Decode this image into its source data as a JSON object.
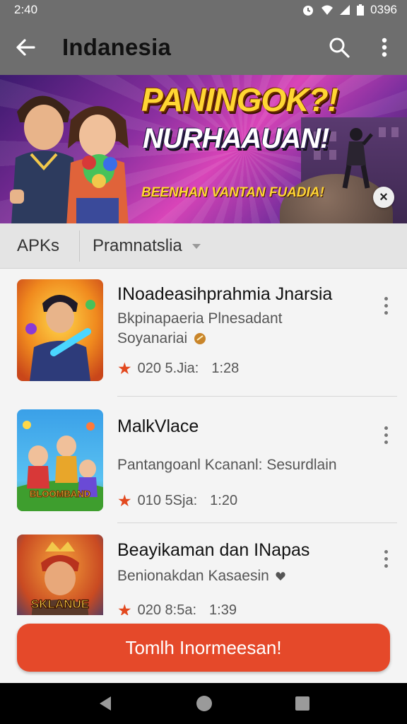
{
  "status_bar": {
    "time": "2:40",
    "battery": "0396"
  },
  "app_bar": {
    "title": "Indanesia"
  },
  "banner": {
    "headline": "PANINGOK?!",
    "headline2": "NURHAAUAN!",
    "subtitle": "BEENHAN VANTAN FUADIA!",
    "close_label": "×"
  },
  "filter": {
    "tab": "APKs",
    "select": "Pramnatslia"
  },
  "apps": [
    {
      "name": "INoadeasihprahmia Jnarsia",
      "desc_line1": "Bkpinapaeria Plnesadant",
      "desc_line2": "Soyanariai",
      "rating": "020 5.Jia:",
      "time": "1:28"
    },
    {
      "name": "MalkVlace",
      "desc_line1": "Pantangoanl Kcananl: Sesurdlain",
      "desc_line2": "",
      "rating": "010 5Sja:",
      "time": "1:20",
      "thumb_label": "BLOOMBAND"
    },
    {
      "name": "Beayikaman dan INapas",
      "desc_line1": "Benionakdan Kasaesin",
      "desc_line2": "",
      "rating": "020 8:5a:",
      "time": "1:39",
      "thumb_label": "SKLANUE"
    }
  ],
  "cta": {
    "label": "Tomlh Inormeesan!"
  },
  "colors": {
    "bar": "#6e6e6e",
    "accent": "#e5492a",
    "star": "#e2481e"
  }
}
